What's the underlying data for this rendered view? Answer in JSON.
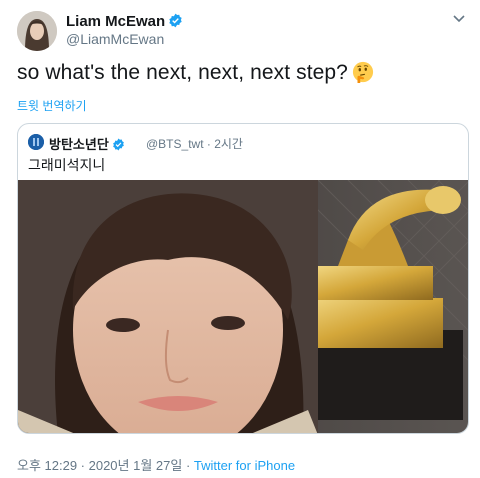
{
  "author": {
    "name": "Liam McEwan",
    "handle": "@LiamMcEwan"
  },
  "tweet": {
    "text": "so what's the next, next, next step?",
    "emoji_icon": "thinking-face-icon",
    "translate_label": "트윗 번역하기"
  },
  "quoted": {
    "name": "방탄소년단",
    "handle": "@BTS_twt",
    "separator": "·",
    "time": "2시간",
    "text": "그래미석지니"
  },
  "footer": {
    "timestamp": "오후 12:29 · 2020년 1월 27일 · ",
    "source": "Twitter for iPhone"
  },
  "colors": {
    "accent": "#1da1f2",
    "muted": "#657786",
    "border": "#ccd6dd"
  }
}
